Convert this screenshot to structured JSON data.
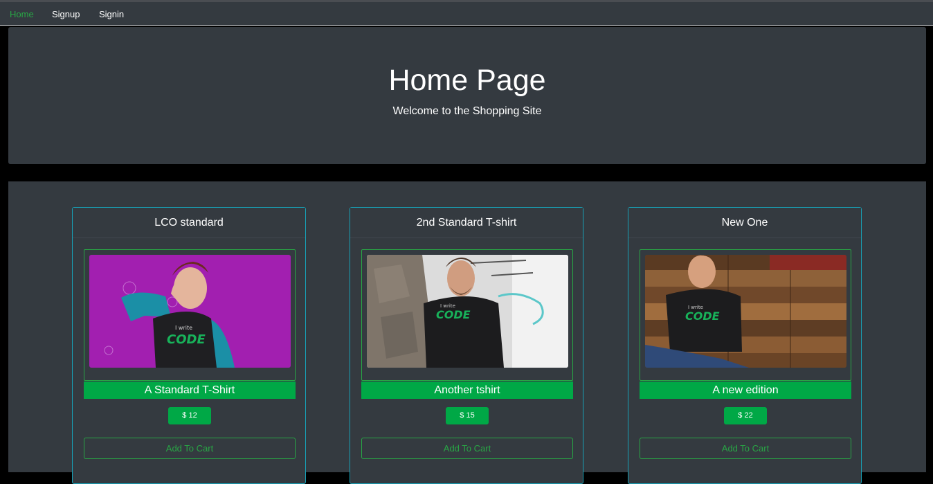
{
  "nav": {
    "items": [
      {
        "label": "Home",
        "active": true
      },
      {
        "label": "Signup",
        "active": false
      },
      {
        "label": "Signin",
        "active": false
      }
    ]
  },
  "hero": {
    "title": "Home Page",
    "subtitle": "Welcome to the Shopping Site"
  },
  "products": [
    {
      "header": "LCO standard",
      "name": "A Standard T-Shirt",
      "price": "$ 12",
      "cart_label": "Add To Cart",
      "image_text_small": "I write",
      "image_text_big": "CODE"
    },
    {
      "header": "2nd Standard T-shirt",
      "name": "Another tshirt",
      "price": "$ 15",
      "cart_label": "Add To Cart",
      "image_text_small": "I write",
      "image_text_big": "CODE"
    },
    {
      "header": "New One",
      "name": "A new edition",
      "price": "$ 22",
      "cart_label": "Add To Cart",
      "image_text_small": "I write",
      "image_text_big": "CODE"
    }
  ],
  "colors": {
    "accent": "#28a745",
    "info_border": "#17a2b8",
    "dark_bg": "#343a40",
    "price_bg": "#00a846"
  }
}
